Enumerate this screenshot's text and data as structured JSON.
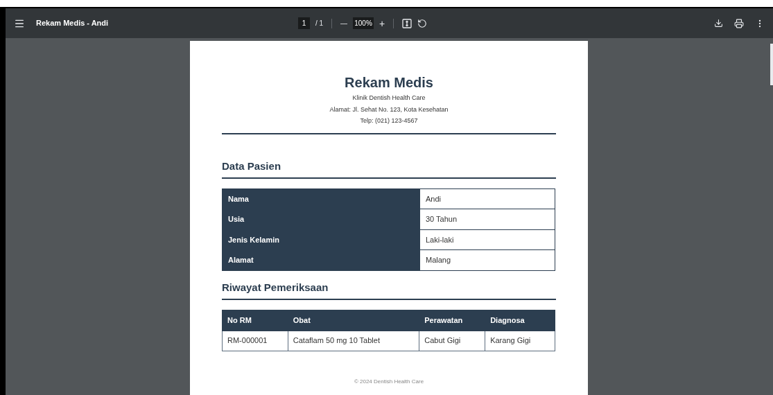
{
  "toolbar": {
    "title": "Rekam Medis - Andi",
    "page_current": "1",
    "page_total": "/ 1",
    "zoom": "100%",
    "zoom_out": "—",
    "zoom_in": "+"
  },
  "document": {
    "title": "Rekam Medis",
    "clinic": "Klinik Dentish Health Care",
    "address": "Alamat: Jl. Sehat No. 123, Kota Kesehatan",
    "phone": "Telp: (021) 123-4567",
    "patient_section": {
      "heading": "Data Pasien",
      "rows": [
        {
          "label": "Nama",
          "value": "Andi"
        },
        {
          "label": "Usia",
          "value": "30 Tahun"
        },
        {
          "label": "Jenis Kelamin",
          "value": "Laki-laki"
        },
        {
          "label": "Alamat",
          "value": "Malang"
        }
      ]
    },
    "history_section": {
      "heading": "Riwayat Pemeriksaan",
      "columns": [
        "No RM",
        "Obat",
        "Perawatan",
        "Diagnosa"
      ],
      "rows": [
        [
          "RM-000001",
          "Cataflam 50 mg 10 Tablet",
          "Cabut Gigi",
          "Karang Gigi"
        ]
      ]
    },
    "footer": "© 2024 Dentish Health Care"
  }
}
